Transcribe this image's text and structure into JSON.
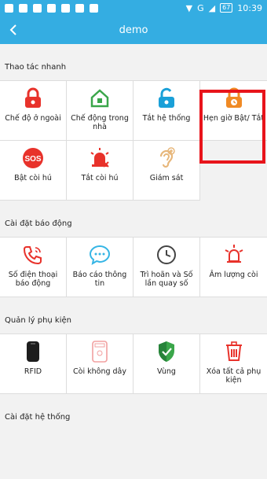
{
  "status": {
    "time": "10:39",
    "battery": "67",
    "network": "G"
  },
  "header": {
    "title": "demo"
  },
  "sections": [
    {
      "title": "Thao tác nhanh",
      "items": [
        {
          "label": "Chế độ ở ngoài",
          "icon": "lock-away-icon"
        },
        {
          "label": "Chế động trong nhà",
          "icon": "home-icon"
        },
        {
          "label": "Tắt hệ thống",
          "icon": "unlock-icon"
        },
        {
          "label": "Hẹn giờ Bật/ Tắt",
          "icon": "timer-lock-icon"
        },
        {
          "label": "Bật còi hú",
          "icon": "sos-icon"
        },
        {
          "label": "Tắt còi hú",
          "icon": "siren-off-icon"
        },
        {
          "label": "Giám sát",
          "icon": "ear-icon"
        }
      ]
    },
    {
      "title": "Cài đặt báo động",
      "items": [
        {
          "label": "Số điện thoại báo động",
          "icon": "phone-icon"
        },
        {
          "label": "Báo cáo thông tin",
          "icon": "message-icon"
        },
        {
          "label": "Trì hoãn và Số lần quay số",
          "icon": "clock-icon"
        },
        {
          "label": "Âm lượng còi",
          "icon": "siren-volume-icon"
        }
      ]
    },
    {
      "title": "Quản lý phụ kiện",
      "items": [
        {
          "label": "RFID",
          "icon": "rfid-icon"
        },
        {
          "label": "Còi không dây",
          "icon": "wireless-siren-icon"
        },
        {
          "label": "Vùng",
          "icon": "shield-icon"
        },
        {
          "label": "Xóa tất cả phụ kiện",
          "icon": "trash-icon"
        }
      ]
    },
    {
      "title": "Cài đặt hệ thống",
      "items": []
    }
  ],
  "colors": {
    "appbar": "#34ade2",
    "red": "#e8322b",
    "green": "#3aa64a",
    "blue": "#1aa0d8",
    "orange": "#f08a24",
    "highlight": "#e8141b"
  }
}
